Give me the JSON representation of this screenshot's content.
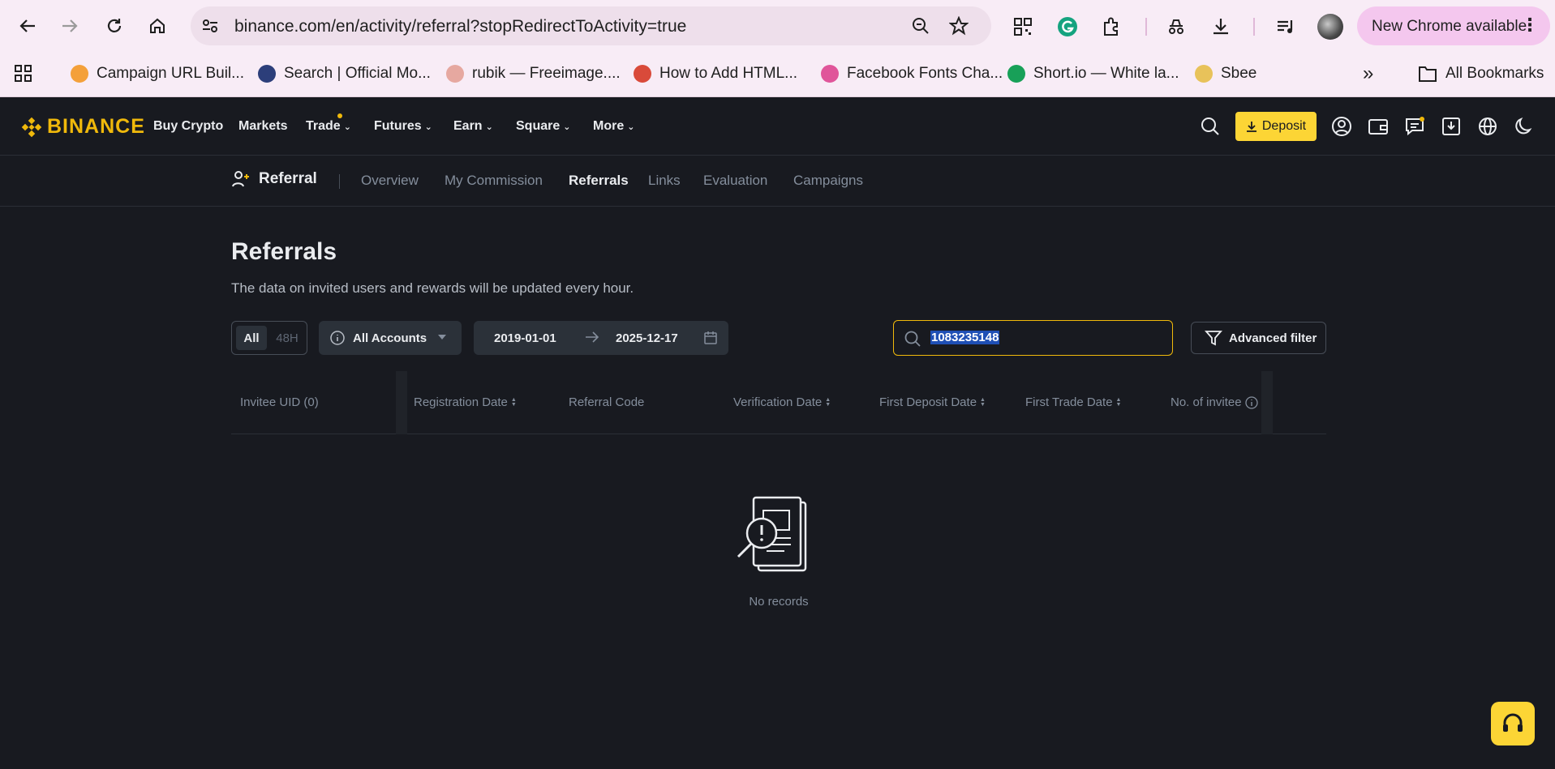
{
  "browser": {
    "url": "binance.com/en/activity/referral?stopRedirectToActivity=true",
    "new_chrome_label": "New Chrome available",
    "menu_glyph": "⋮",
    "bookmarks": [
      {
        "label": "Campaign URL Buil...",
        "color": "#f4a03a"
      },
      {
        "label": "Search | Official Mo...",
        "color": "#2c3e7a"
      },
      {
        "label": "rubik — Freeimage....",
        "color": "#e6a8a0"
      },
      {
        "label": "How to Add HTML...",
        "color": "#d94a3a"
      },
      {
        "label": "Facebook Fonts Cha...",
        "color": "#e0559a"
      },
      {
        "label": "Short.io — White la...",
        "color": "#18a058"
      },
      {
        "label": "Sbee",
        "color": "#e8c25a"
      }
    ],
    "overflow_glyph": "»",
    "all_bookmarks": "All Bookmarks"
  },
  "header": {
    "logo": "BINANCE",
    "nav": [
      "Buy Crypto",
      "Markets",
      "Trade",
      "Futures",
      "Earn",
      "Square",
      "More"
    ],
    "deposit": "Deposit",
    "accent": "#f0b90b"
  },
  "subnav": {
    "title": "Referral",
    "links": [
      "Overview",
      "My Commission",
      "Referrals",
      "Links",
      "Evaluation",
      "Campaigns"
    ],
    "active": "Referrals"
  },
  "main": {
    "title": "Referrals",
    "description": "The data on invited users and rewards will be updated every hour.",
    "range_all": "All",
    "range_48h": "48H",
    "accounts": "All Accounts",
    "date_from": "2019-01-01",
    "date_to": "2025-12-17",
    "search_value": "1083235148",
    "advanced_filter": "Advanced filter",
    "columns": [
      "Invitee UID (0)",
      "Registration Date",
      "Referral Code",
      "Verification Date",
      "First Deposit Date",
      "First Trade Date",
      "No. of invitee"
    ],
    "empty": "No records"
  }
}
